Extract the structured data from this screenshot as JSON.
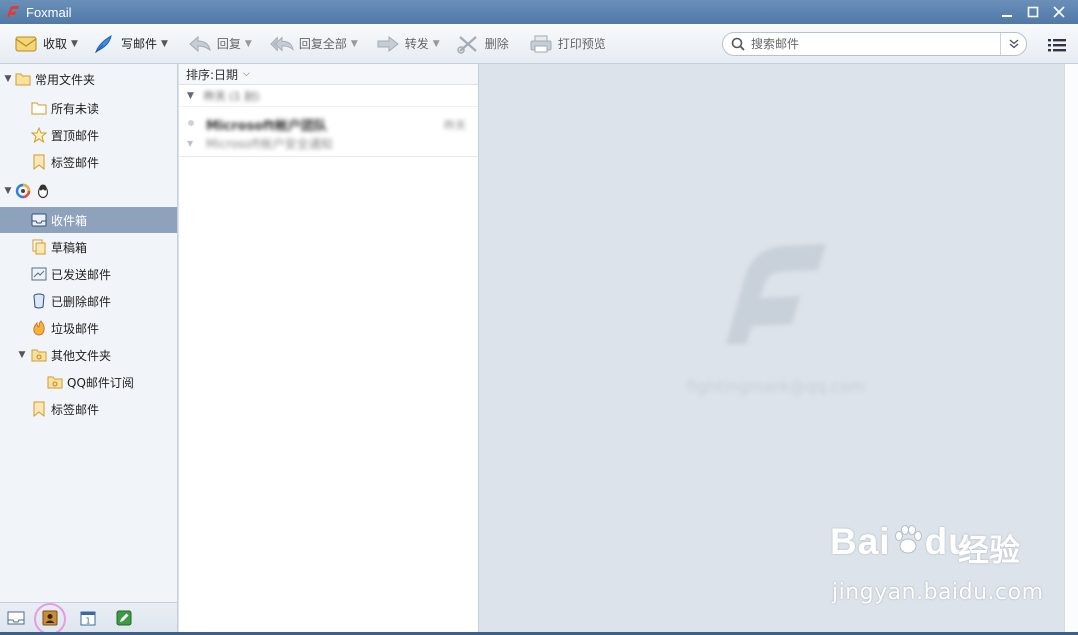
{
  "window": {
    "title": "Foxmail"
  },
  "toolbar": {
    "receive": "收取",
    "compose": "写邮件",
    "reply": "回复",
    "reply_all": "回复全部",
    "forward": "转发",
    "delete": "删除",
    "print_preview": "打印预览",
    "search_placeholder": "搜索邮件"
  },
  "sidebar": {
    "common_folders": "常用文件夹",
    "items_common": [
      "所有未读",
      "置顶邮件",
      "标签邮件"
    ],
    "account_label": "",
    "inbox": "收件箱",
    "drafts": "草稿箱",
    "sent": "已发送邮件",
    "deleted": "已删除邮件",
    "junk": "垃圾邮件",
    "other_folders": "其他文件夹",
    "qq_subscription": "QQ邮件订阅",
    "tag_mail": "标签邮件"
  },
  "maillist": {
    "sort_label": "排序:日期",
    "group_label": "昨天 (1 封)",
    "items": [
      {
        "sender": "Microsoft帐户团队",
        "date": "昨天",
        "subject": "Microsoft帐户安全通知"
      }
    ]
  },
  "preview": {
    "account_email": "fightingmark@qq.com"
  },
  "watermark": {
    "baidu_text": "Bai",
    "baidu_du": "du",
    "baidu_cn": "经验",
    "baidu_url": "jingyan.baidu.com"
  },
  "colors": {
    "accent": "#5079a8",
    "selected": "#8fa2bc",
    "preview_bg": "#dde3ea"
  }
}
